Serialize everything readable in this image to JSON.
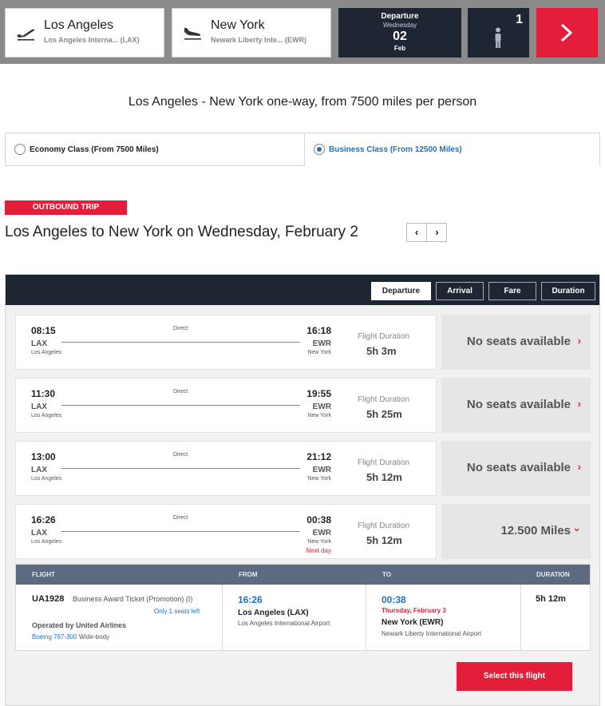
{
  "search": {
    "origin": {
      "city": "Los Angeles",
      "airport": "Los Angeles Interna... (LAX)"
    },
    "destination": {
      "city": "New York",
      "airport": "Newark Liberty Inte... (EWR)"
    },
    "departure": {
      "label": "Departure",
      "weekday": "Wednesday",
      "day": "02",
      "month": "Feb"
    },
    "passengers": "1"
  },
  "summary": "Los Angeles - New York one-way, from 7500 miles per person",
  "cabin_options": [
    {
      "label": "Economy Class (From 7500 Miles)",
      "selected": false
    },
    {
      "label": "Business Class (From 12500 Miles)",
      "selected": true
    }
  ],
  "outbound": {
    "tag": "OUTBOUND TRIP",
    "title": "Los Angeles to New York on Wednesday, February 2",
    "prev": "‹",
    "next": "›"
  },
  "sort_options": [
    "Departure",
    "Arrival",
    "Fare",
    "Duration"
  ],
  "sort_active": "Departure",
  "duration_label": "Flight Duration",
  "flights": [
    {
      "dep_time": "08:15",
      "dep_code": "LAX",
      "dep_city": "Los Angeles",
      "stops": "Direct",
      "arr_time": "16:18",
      "arr_code": "EWR",
      "arr_city": "New York",
      "next_day": "",
      "duration": "5h 3m",
      "availability": "No seats available",
      "chevron": "›"
    },
    {
      "dep_time": "11:30",
      "dep_code": "LAX",
      "dep_city": "Los Angeles",
      "stops": "Direct",
      "arr_time": "19:55",
      "arr_code": "EWR",
      "arr_city": "New York",
      "next_day": "",
      "duration": "5h 25m",
      "availability": "No seats available",
      "chevron": "›"
    },
    {
      "dep_time": "13:00",
      "dep_code": "LAX",
      "dep_city": "Los Angeles",
      "stops": "Direct",
      "arr_time": "21:12",
      "arr_code": "EWR",
      "arr_city": "New York",
      "next_day": "",
      "duration": "5h 12m",
      "availability": "No seats available",
      "chevron": "›"
    },
    {
      "dep_time": "16:26",
      "dep_code": "LAX",
      "dep_city": "Los Angeles",
      "stops": "Direct",
      "arr_time": "00:38",
      "arr_code": "EWR",
      "arr_city": "New York",
      "next_day": "Next day",
      "duration": "5h 12m",
      "availability": "12.500 Miles",
      "chevron": "⌄"
    }
  ],
  "details": {
    "headers": {
      "flight": "FLIGHT",
      "from": "FROM",
      "to": "TO",
      "duration": "DURATION"
    },
    "flight_no": "UA1928",
    "ticket": "Business Award Ticket (Promotion) (I)",
    "seats_left": "Only 1 seats left",
    "operated_by": "Operated by United Airlines",
    "aircraft": "Boeing 767-300",
    "aircraft_suffix": " Wide-body",
    "from": {
      "time": "16:26",
      "city": "Los Angeles (LAX)",
      "airport": "Los Angeles International Airport"
    },
    "to": {
      "time": "00:38",
      "date": "Thursday, February 3",
      "city": "New York (EWR)",
      "airport": "Newark Liberty International Airport"
    },
    "duration": "5h 12m",
    "select_label": "Select this flight"
  },
  "colors": {
    "brand_red": "#e41d3a",
    "navy": "#1f2633",
    "link_blue": "#1a73c8",
    "table_header": "#5c6a80"
  },
  "icons": [
    "plane-takeoff-icon",
    "plane-landing-icon",
    "person-icon",
    "chevron-right-icon",
    "chevron-down-icon"
  ]
}
